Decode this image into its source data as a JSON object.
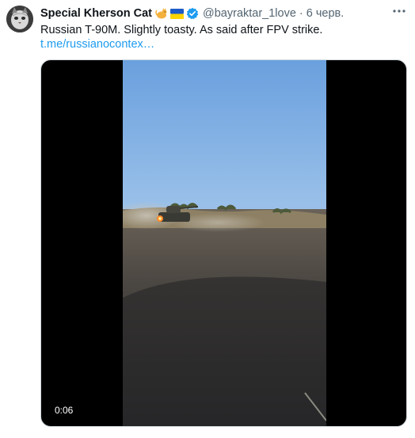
{
  "tweet": {
    "author_name": "Special Kherson Cat",
    "emoji_icons": [
      "cat-icon",
      "ukraine-flag-icon"
    ],
    "handle": "@bayraktar_1love",
    "separator": "·",
    "time": "6 черв.",
    "text": "Russian T-90M. Slightly toasty. As said after FPV strike.",
    "link": "t.me/russianocontex…",
    "more_icon": "more-icon"
  },
  "media": {
    "type": "video",
    "duration": "0:06"
  },
  "colors": {
    "link": "#1d9bf0",
    "secondary_text": "#536471",
    "verified": "#1d9bf0"
  }
}
